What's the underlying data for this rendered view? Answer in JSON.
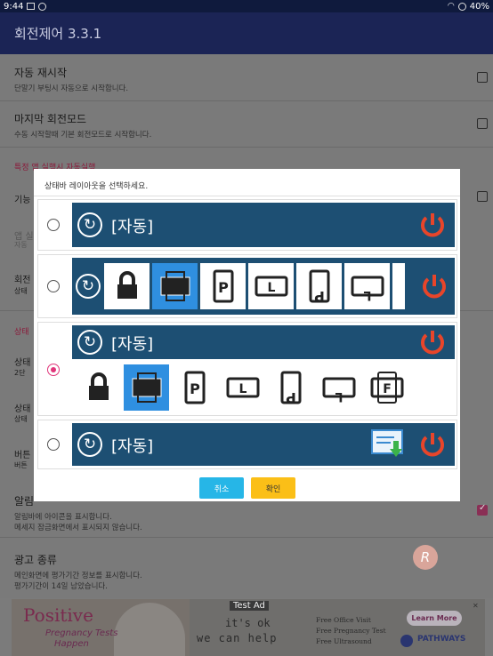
{
  "status_bar": {
    "time": "9:44",
    "battery": "40%"
  },
  "app": {
    "title": "회전제어 3.3.1"
  },
  "settings": {
    "auto_restart": {
      "title": "자동 재시작",
      "summary": "단말기 부팅시 자동으로 시작합니다."
    },
    "last_mode": {
      "title": "마지막 회전모드",
      "summary": "수동 시작할때 기본 회전모드로 시작합니다."
    },
    "category_partial": "특정 앱 실행시 자동실행",
    "peek_func": "기능",
    "peek_app": "앱 실",
    "peek_app_sub": "자동",
    "peek_rot": "회전",
    "peek_rot_sub": "상태",
    "category2_partial": "상태",
    "peek_st1": "상태",
    "peek_st1_sub": "2단",
    "peek_st2": "상태",
    "peek_st2_sub": "상태",
    "peek_btn": "버튼",
    "peek_btn_sub": "버튼",
    "alarm": {
      "title": "알림",
      "summary1": "알림바에 아이콘을 표시합니다.",
      "summary2": "메세지 잠금화면에서 표시되지 않습니다."
    },
    "ad_type": {
      "title": "광고 종류",
      "summary1": "메인화면에 평가기간 정보를 표시합니다.",
      "summary2": "평가기간이 14일 남았습니다."
    }
  },
  "dialog": {
    "title": "상태바 레이아웃을 선택하세요.",
    "auto_label": "[자동]",
    "cancel_label": "취소",
    "ok_label": "확인",
    "selected_option": 3
  },
  "ad": {
    "headline": "Positive",
    "sub1": "Pregnancy Tests",
    "sub2": "Happen",
    "test_label": "Test Ad",
    "line1": "it's ok",
    "line2": "we can help",
    "free1": "Free Office Visit",
    "free2": "Free Pregnancy Test",
    "free3": "Free Ultrasound",
    "cta": "Learn More",
    "brand": "PATHWAYS"
  },
  "colors": {
    "bar": "#1d4f73",
    "radio_selected": "#e0357a",
    "cancel": "#26b6e7",
    "ok": "#fbbf17",
    "power": "#e8452a"
  }
}
